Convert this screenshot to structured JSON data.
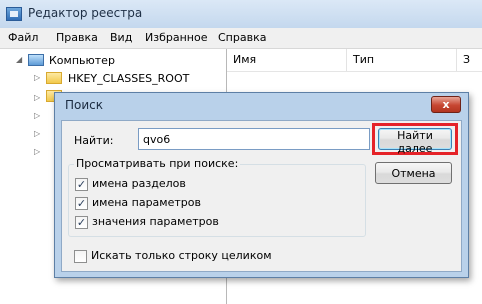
{
  "window": {
    "title": "Редактор реестра"
  },
  "menu": [
    "Файл",
    "Правка",
    "Вид",
    "Избранное",
    "Справка"
  ],
  "tree": {
    "root": "Компьютер",
    "first_key": "HKEY_CLASSES_ROOT"
  },
  "list": {
    "columns": [
      "Имя",
      "Тип",
      "З"
    ]
  },
  "dialog": {
    "title": "Поиск",
    "close_label": "x",
    "find_label": "Найти:",
    "find_value": "qvo6",
    "find_next_label": "Найти далее",
    "cancel_label": "Отмена",
    "look_at_label": "Просматривать при поиске:",
    "options": [
      {
        "label": "имена разделов",
        "checked": true
      },
      {
        "label": "имена параметров",
        "checked": true
      },
      {
        "label": "значения параметров",
        "checked": true
      }
    ],
    "whole_string": {
      "label": "Искать только строку целиком",
      "checked": false
    }
  },
  "colors": {
    "highlight": "#e52228",
    "dialog_frame": "#b9d1ea"
  }
}
